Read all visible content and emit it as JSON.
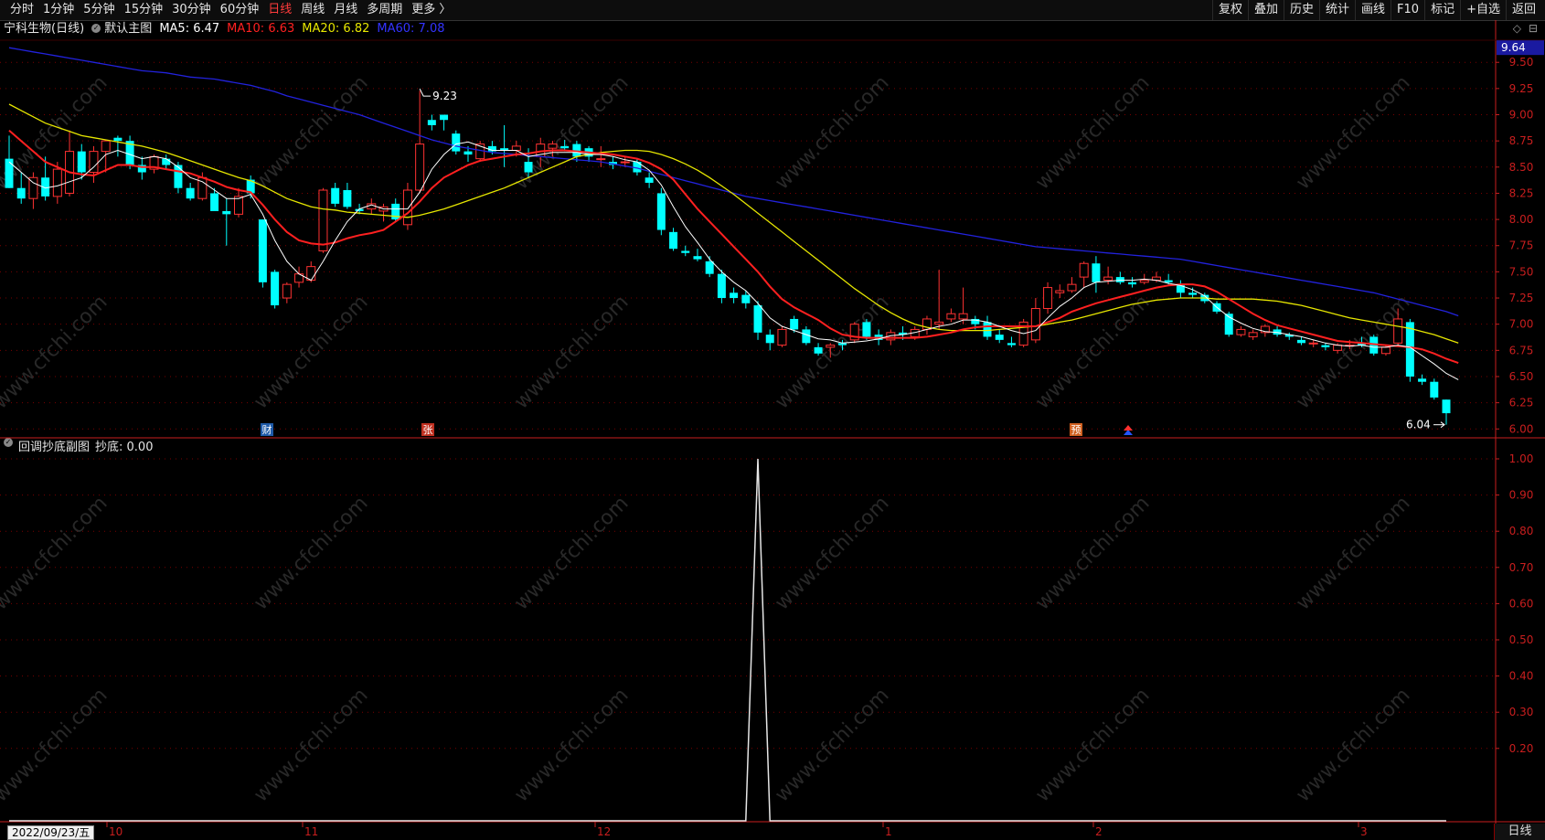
{
  "toolbar": {
    "left": [
      "分时",
      "1分钟",
      "5分钟",
      "15分钟",
      "30分钟",
      "60分钟",
      "日线",
      "周线",
      "月线",
      "多周期",
      "更多 〉"
    ],
    "active_index": 6,
    "right": [
      "复权",
      "叠加",
      "历史",
      "统计",
      "画线",
      "F10",
      "标记",
      "+自选",
      "返回"
    ]
  },
  "main_legend": {
    "stock": "宁科生物(日线)",
    "template": "默认主图",
    "ma5": "MA5: 6.47",
    "ma10": "MA10: 6.63",
    "ma20": "MA20: 6.82",
    "ma60": "MA60: 7.08"
  },
  "sub_legend": {
    "name": "回调抄底副图",
    "value": "抄底: 0.00"
  },
  "colors": {
    "up": "#ff3232",
    "down": "#00ffff",
    "ma5": "#ffffff",
    "ma10": "#ff2020",
    "ma20": "#e6e600",
    "ma60": "#2222dd",
    "grid": "#7a0000",
    "axis": "#c81e1e"
  },
  "right_tools": [
    "◇",
    "⊟"
  ],
  "price_axis": {
    "current_price": "9.64",
    "labels": [
      "9.50",
      "9.25",
      "9.00",
      "8.75",
      "8.50",
      "8.25",
      "8.00",
      "7.75",
      "7.50",
      "7.25",
      "7.00",
      "6.75",
      "6.50",
      "6.25",
      "6.00"
    ]
  },
  "sub_axis": {
    "labels": [
      "1.00",
      "0.90",
      "0.80",
      "0.70",
      "0.60",
      "0.50",
      "0.40",
      "0.30",
      "0.20"
    ]
  },
  "annotations": {
    "high": "9.23",
    "low": "6.04"
  },
  "event_markers": [
    {
      "label": "财",
      "kind": "blue"
    },
    {
      "label": "张",
      "kind": "red"
    },
    {
      "label": "预",
      "kind": "orange"
    },
    {
      "label": "≈",
      "kind": "redblue"
    }
  ],
  "time_axis": {
    "date_box": "2022/09/23/五",
    "labels": [
      "10",
      "11",
      "12",
      "1",
      "2",
      "3"
    ]
  },
  "bottom_tab": "日线",
  "watermark": "www.cfchi.com",
  "chart_data": {
    "type": "candlestick",
    "candles": [
      [
        8.58,
        8.8,
        8.3,
        8.3
      ],
      [
        8.3,
        8.45,
        8.15,
        8.2
      ],
      [
        8.2,
        8.45,
        8.1,
        8.4
      ],
      [
        8.4,
        8.6,
        8.18,
        8.22
      ],
      [
        8.22,
        8.55,
        8.15,
        8.48
      ],
      [
        8.25,
        8.85,
        8.22,
        8.65
      ],
      [
        8.65,
        8.72,
        8.38,
        8.45
      ],
      [
        8.45,
        8.7,
        8.35,
        8.65
      ],
      [
        8.65,
        8.76,
        8.45,
        8.75
      ],
      [
        8.78,
        8.8,
        8.6,
        8.75
      ],
      [
        8.75,
        8.8,
        8.48,
        8.52
      ],
      [
        8.52,
        8.6,
        8.38,
        8.45
      ],
      [
        8.48,
        8.62,
        8.44,
        8.6
      ],
      [
        8.58,
        8.62,
        8.48,
        8.52
      ],
      [
        8.52,
        8.55,
        8.25,
        8.3
      ],
      [
        8.3,
        8.35,
        8.18,
        8.2
      ],
      [
        8.2,
        8.45,
        8.18,
        8.4
      ],
      [
        8.25,
        8.3,
        8.1,
        8.08
      ],
      [
        8.08,
        8.2,
        7.75,
        8.05
      ],
      [
        8.05,
        8.3,
        8.02,
        8.22
      ],
      [
        8.38,
        8.42,
        8.2,
        8.25
      ],
      [
        8.0,
        8.0,
        7.35,
        7.4
      ],
      [
        7.5,
        7.52,
        7.15,
        7.18
      ],
      [
        7.25,
        7.4,
        7.2,
        7.38
      ],
      [
        7.4,
        7.55,
        7.35,
        7.48
      ],
      [
        7.42,
        7.6,
        7.4,
        7.55
      ],
      [
        7.7,
        8.3,
        7.68,
        8.28
      ],
      [
        8.3,
        8.35,
        8.12,
        8.15
      ],
      [
        8.28,
        8.35,
        8.1,
        8.12
      ],
      [
        8.1,
        8.15,
        8.05,
        8.08
      ],
      [
        8.1,
        8.2,
        8.05,
        8.15
      ],
      [
        8.08,
        8.15,
        7.98,
        8.12
      ],
      [
        8.15,
        8.2,
        7.98,
        8.0
      ],
      [
        7.95,
        8.35,
        7.9,
        8.28
      ],
      [
        8.28,
        9.23,
        8.25,
        8.72
      ],
      [
        8.95,
        9.0,
        8.85,
        8.9
      ],
      [
        9.0,
        9.0,
        8.85,
        8.95
      ],
      [
        8.82,
        8.85,
        8.62,
        8.65
      ],
      [
        8.65,
        8.7,
        8.55,
        8.62
      ],
      [
        8.58,
        8.75,
        8.55,
        8.72
      ],
      [
        8.7,
        8.75,
        8.62,
        8.65
      ],
      [
        8.68,
        8.9,
        8.5,
        8.66
      ],
      [
        8.66,
        8.75,
        8.6,
        8.7
      ],
      [
        8.55,
        8.68,
        8.4,
        8.45
      ],
      [
        8.6,
        8.78,
        8.5,
        8.72
      ],
      [
        8.68,
        8.75,
        8.6,
        8.72
      ],
      [
        8.7,
        8.76,
        8.65,
        8.68
      ],
      [
        8.72,
        8.75,
        8.55,
        8.6
      ],
      [
        8.68,
        8.7,
        8.55,
        8.6
      ],
      [
        8.58,
        8.7,
        8.5,
        8.58
      ],
      [
        8.55,
        8.6,
        8.48,
        8.52
      ],
      [
        8.55,
        8.6,
        8.5,
        8.55
      ],
      [
        8.55,
        8.58,
        8.42,
        8.45
      ],
      [
        8.4,
        8.45,
        8.3,
        8.35
      ],
      [
        8.25,
        8.3,
        7.85,
        7.9
      ],
      [
        7.88,
        7.92,
        7.7,
        7.72
      ],
      [
        7.7,
        7.75,
        7.65,
        7.68
      ],
      [
        7.65,
        7.72,
        7.6,
        7.62
      ],
      [
        7.6,
        7.65,
        7.45,
        7.48
      ],
      [
        7.48,
        7.52,
        7.2,
        7.25
      ],
      [
        7.3,
        7.35,
        7.2,
        7.25
      ],
      [
        7.28,
        7.32,
        7.15,
        7.2
      ],
      [
        7.18,
        7.22,
        6.85,
        6.92
      ],
      [
        6.9,
        6.95,
        6.75,
        6.82
      ],
      [
        6.8,
        6.98,
        6.78,
        6.95
      ],
      [
        7.05,
        7.08,
        6.92,
        6.95
      ],
      [
        6.95,
        6.98,
        6.8,
        6.82
      ],
      [
        6.78,
        6.82,
        6.7,
        6.72
      ],
      [
        6.78,
        6.82,
        6.68,
        6.8
      ],
      [
        6.82,
        6.85,
        6.75,
        6.8
      ],
      [
        6.85,
        7.02,
        6.82,
        7.0
      ],
      [
        7.02,
        7.05,
        6.85,
        6.88
      ],
      [
        6.9,
        6.95,
        6.8,
        6.85
      ],
      [
        6.85,
        6.95,
        6.8,
        6.92
      ],
      [
        6.92,
        6.98,
        6.85,
        6.9
      ],
      [
        6.88,
        6.98,
        6.85,
        6.95
      ],
      [
        6.95,
        7.08,
        6.9,
        7.05
      ],
      [
        7.0,
        7.52,
        6.95,
        7.02
      ],
      [
        7.05,
        7.15,
        7.02,
        7.1
      ],
      [
        7.05,
        7.35,
        7.0,
        7.1
      ],
      [
        7.05,
        7.08,
        6.95,
        7.0
      ],
      [
        7.02,
        7.08,
        6.85,
        6.88
      ],
      [
        6.9,
        6.95,
        6.82,
        6.85
      ],
      [
        6.82,
        6.88,
        6.78,
        6.8
      ],
      [
        6.8,
        7.05,
        6.78,
        7.02
      ],
      [
        6.85,
        7.25,
        6.82,
        7.15
      ],
      [
        7.15,
        7.4,
        7.1,
        7.35
      ],
      [
        7.3,
        7.38,
        7.25,
        7.32
      ],
      [
        7.32,
        7.45,
        7.3,
        7.38
      ],
      [
        7.45,
        7.6,
        7.35,
        7.58
      ],
      [
        7.58,
        7.65,
        7.3,
        7.4
      ],
      [
        7.42,
        7.55,
        7.38,
        7.45
      ],
      [
        7.45,
        7.5,
        7.38,
        7.4
      ],
      [
        7.4,
        7.45,
        7.35,
        7.38
      ],
      [
        7.4,
        7.48,
        7.38,
        7.42
      ],
      [
        7.42,
        7.5,
        7.4,
        7.45
      ],
      [
        7.42,
        7.48,
        7.38,
        7.4
      ],
      [
        7.38,
        7.42,
        7.25,
        7.3
      ],
      [
        7.3,
        7.35,
        7.25,
        7.28
      ],
      [
        7.28,
        7.3,
        7.2,
        7.22
      ],
      [
        7.2,
        7.22,
        7.1,
        7.12
      ],
      [
        7.1,
        7.12,
        6.88,
        6.9
      ],
      [
        6.9,
        6.98,
        6.88,
        6.95
      ],
      [
        6.88,
        6.95,
        6.85,
        6.92
      ],
      [
        6.92,
        7.0,
        6.88,
        6.98
      ],
      [
        6.95,
        6.98,
        6.88,
        6.9
      ],
      [
        6.9,
        6.92,
        6.85,
        6.88
      ],
      [
        6.85,
        6.88,
        6.8,
        6.82
      ],
      [
        6.82,
        6.85,
        6.78,
        6.82
      ],
      [
        6.8,
        6.82,
        6.75,
        6.78
      ],
      [
        6.75,
        6.82,
        6.72,
        6.8
      ],
      [
        6.8,
        6.85,
        6.76,
        6.8
      ],
      [
        6.82,
        6.88,
        6.78,
        6.8
      ],
      [
        6.88,
        6.9,
        6.7,
        6.72
      ],
      [
        6.72,
        6.8,
        6.7,
        6.78
      ],
      [
        6.82,
        7.15,
        6.8,
        7.05
      ],
      [
        7.02,
        7.05,
        6.45,
        6.5
      ],
      [
        6.48,
        6.52,
        6.42,
        6.45
      ],
      [
        6.45,
        6.48,
        6.28,
        6.3
      ],
      [
        6.28,
        6.28,
        6.04,
        6.15
      ]
    ],
    "ma5": [
      8.55,
      8.45,
      8.35,
      8.3,
      8.32,
      8.36,
      8.4,
      8.5,
      8.62,
      8.66,
      8.62,
      8.58,
      8.6,
      8.58,
      8.5,
      8.4,
      8.36,
      8.28,
      8.2,
      8.2,
      8.24,
      8.05,
      7.8,
      7.6,
      7.48,
      7.42,
      7.6,
      7.8,
      7.98,
      8.1,
      8.14,
      8.1,
      8.1,
      8.1,
      8.26,
      8.48,
      8.62,
      8.72,
      8.74,
      8.7,
      8.66,
      8.66,
      8.66,
      8.6,
      8.62,
      8.64,
      8.64,
      8.64,
      8.62,
      8.62,
      8.6,
      8.57,
      8.55,
      8.47,
      8.33,
      8.12,
      7.93,
      7.78,
      7.62,
      7.5,
      7.4,
      7.32,
      7.2,
      7.06,
      6.98,
      6.94,
      6.9,
      6.86,
      6.85,
      6.82,
      6.83,
      6.84,
      6.86,
      6.89,
      6.9,
      6.92,
      6.95,
      6.98,
      7.0,
      7.04,
      7.04,
      7.02,
      6.98,
      6.94,
      6.91,
      6.94,
      7.06,
      7.17,
      7.25,
      7.35,
      7.4,
      7.41,
      7.42,
      7.42,
      7.43,
      7.42,
      7.39,
      7.37,
      7.33,
      7.27,
      7.16,
      7.07,
      7.01,
      6.96,
      6.93,
      6.92,
      6.9,
      6.88,
      6.85,
      6.82,
      6.8,
      6.79,
      6.8,
      6.78,
      6.78,
      6.8,
      6.78,
      6.7,
      6.62,
      6.53,
      6.47
    ],
    "ma10": [
      8.85,
      8.75,
      8.65,
      8.55,
      8.5,
      8.45,
      8.43,
      8.42,
      8.47,
      8.52,
      8.52,
      8.5,
      8.5,
      8.48,
      8.46,
      8.44,
      8.4,
      8.36,
      8.31,
      8.28,
      8.26,
      8.14,
      8.0,
      7.88,
      7.8,
      7.77,
      7.76,
      7.78,
      7.82,
      7.85,
      7.87,
      7.9,
      7.98,
      8.06,
      8.17,
      8.3,
      8.4,
      8.46,
      8.52,
      8.56,
      8.58,
      8.6,
      8.62,
      8.63,
      8.65,
      8.66,
      8.66,
      8.65,
      8.64,
      8.63,
      8.62,
      8.6,
      8.58,
      8.54,
      8.48,
      8.38,
      8.24,
      8.1,
      7.98,
      7.86,
      7.74,
      7.62,
      7.5,
      7.36,
      7.24,
      7.16,
      7.1,
      7.04,
      6.96,
      6.9,
      6.88,
      6.87,
      6.87,
      6.87,
      6.87,
      6.87,
      6.88,
      6.9,
      6.92,
      6.95,
      6.97,
      6.98,
      6.98,
      6.98,
      6.98,
      6.98,
      7.02,
      7.06,
      7.12,
      7.16,
      7.2,
      7.23,
      7.26,
      7.29,
      7.32,
      7.35,
      7.37,
      7.38,
      7.38,
      7.36,
      7.31,
      7.24,
      7.17,
      7.1,
      7.04,
      6.99,
      6.96,
      6.93,
      6.9,
      6.87,
      6.84,
      6.83,
      6.82,
      6.81,
      6.8,
      6.79,
      6.78,
      6.76,
      6.72,
      6.67,
      6.63
    ],
    "ma20": [
      9.1,
      9.04,
      8.98,
      8.92,
      8.88,
      8.84,
      8.8,
      8.78,
      8.76,
      8.74,
      8.72,
      8.7,
      8.67,
      8.64,
      8.6,
      8.56,
      8.52,
      8.48,
      8.44,
      8.4,
      8.37,
      8.32,
      8.26,
      8.2,
      8.16,
      8.12,
      8.1,
      8.09,
      8.07,
      8.06,
      8.05,
      8.04,
      8.03,
      8.02,
      8.04,
      8.07,
      8.1,
      8.14,
      8.18,
      8.22,
      8.26,
      8.3,
      8.35,
      8.4,
      8.45,
      8.5,
      8.55,
      8.6,
      8.62,
      8.64,
      8.65,
      8.66,
      8.66,
      8.65,
      8.62,
      8.58,
      8.53,
      8.47,
      8.4,
      8.32,
      8.24,
      8.15,
      8.06,
      7.97,
      7.88,
      7.79,
      7.7,
      7.61,
      7.52,
      7.43,
      7.34,
      7.26,
      7.18,
      7.11,
      7.05,
      7.0,
      6.97,
      6.95,
      6.94,
      6.94,
      6.94,
      6.94,
      6.95,
      6.96,
      6.97,
      6.98,
      7.0,
      7.02,
      7.04,
      7.07,
      7.1,
      7.13,
      7.16,
      7.19,
      7.21,
      7.23,
      7.24,
      7.25,
      7.25,
      7.25,
      7.24,
      7.24,
      7.24,
      7.24,
      7.23,
      7.22,
      7.2,
      7.18,
      7.15,
      7.12,
      7.09,
      7.06,
      7.04,
      7.02,
      7.0,
      6.98,
      6.96,
      6.93,
      6.9,
      6.86,
      6.82
    ],
    "ma60": [
      9.64,
      9.62,
      9.6,
      9.58,
      9.56,
      9.54,
      9.52,
      9.5,
      9.48,
      9.46,
      9.44,
      9.42,
      9.41,
      9.4,
      9.38,
      9.36,
      9.35,
      9.34,
      9.32,
      9.3,
      9.28,
      9.25,
      9.22,
      9.18,
      9.15,
      9.12,
      9.09,
      9.06,
      9.03,
      9.0,
      8.96,
      8.92,
      8.88,
      8.84,
      8.8,
      8.76,
      8.73,
      8.7,
      8.68,
      8.66,
      8.64,
      8.63,
      8.62,
      8.61,
      8.6,
      8.59,
      8.58,
      8.57,
      8.56,
      8.55,
      8.53,
      8.51,
      8.49,
      8.46,
      8.43,
      8.4,
      8.37,
      8.34,
      8.31,
      8.28,
      8.25,
      8.22,
      8.2,
      8.18,
      8.16,
      8.14,
      8.12,
      8.1,
      8.08,
      8.06,
      8.04,
      8.02,
      8.0,
      7.98,
      7.96,
      7.94,
      7.92,
      7.9,
      7.88,
      7.86,
      7.84,
      7.82,
      7.8,
      7.78,
      7.76,
      7.74,
      7.73,
      7.72,
      7.71,
      7.7,
      7.69,
      7.68,
      7.67,
      7.66,
      7.65,
      7.64,
      7.63,
      7.62,
      7.6,
      7.58,
      7.56,
      7.54,
      7.52,
      7.5,
      7.48,
      7.46,
      7.44,
      7.42,
      7.4,
      7.38,
      7.36,
      7.34,
      7.32,
      7.3,
      7.27,
      7.24,
      7.21,
      7.18,
      7.15,
      7.12,
      7.08
    ],
    "indicator": {
      "name": "抄底",
      "spike_index": 62,
      "spike_value": 1.0,
      "baseline": 0.0
    }
  }
}
